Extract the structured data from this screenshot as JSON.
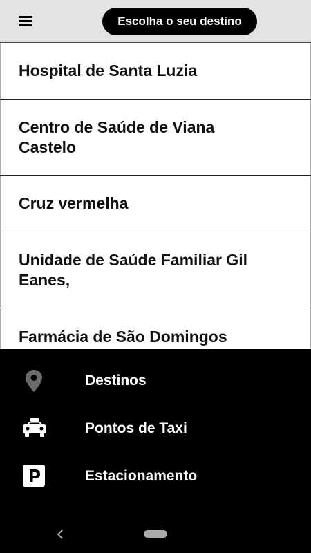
{
  "header": {
    "menu_icon": "hamburger-menu-icon",
    "destination_button_label": "Escolha o seu destino"
  },
  "destinations": [
    {
      "label": "Hospital de Santa Luzia"
    },
    {
      "label": "Centro de Saúde de Viana Castelo"
    },
    {
      "label": "Cruz vermelha"
    },
    {
      "label": "Unidade de Saúde Familiar Gil Eanes,"
    },
    {
      "label": "Farmácia de São Domingos"
    }
  ],
  "bottom_nav": {
    "items": [
      {
        "label": "Destinos",
        "icon": "location-pin-icon"
      },
      {
        "label": "Pontos de Taxi",
        "icon": "taxi-icon"
      },
      {
        "label": "Estacionamento",
        "icon": "parking-icon"
      }
    ]
  },
  "system_nav": {
    "back_icon": "back-chevron-icon",
    "home_icon": "home-pill-icon"
  },
  "colors": {
    "header_bg": "#e3e3e3",
    "pill_bg": "#000000",
    "nav_bg": "#000000",
    "pin_color": "#6b6b6b"
  }
}
